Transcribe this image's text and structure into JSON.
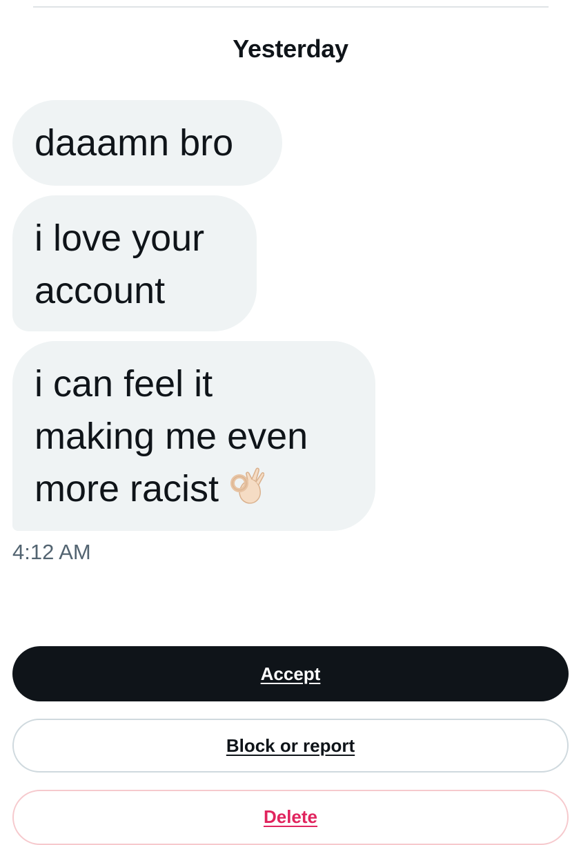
{
  "conversation": {
    "date_header": "Yesterday",
    "messages": [
      {
        "lines": [
          "daaamn bro"
        ]
      },
      {
        "lines": [
          "i love your",
          "account"
        ]
      },
      {
        "lines": [
          "i can feel it",
          "making me even",
          "more racist"
        ],
        "emoji": "ok-hand"
      }
    ],
    "timestamp": "4:12 AM"
  },
  "actions": {
    "accept_label": "Accept",
    "block_label": "Block or report",
    "delete_label": "Delete"
  },
  "colors": {
    "bubble_bg": "#eff3f4",
    "accept_bg": "#0f1419",
    "delete_text": "#e0245e",
    "timestamp": "#536471"
  }
}
